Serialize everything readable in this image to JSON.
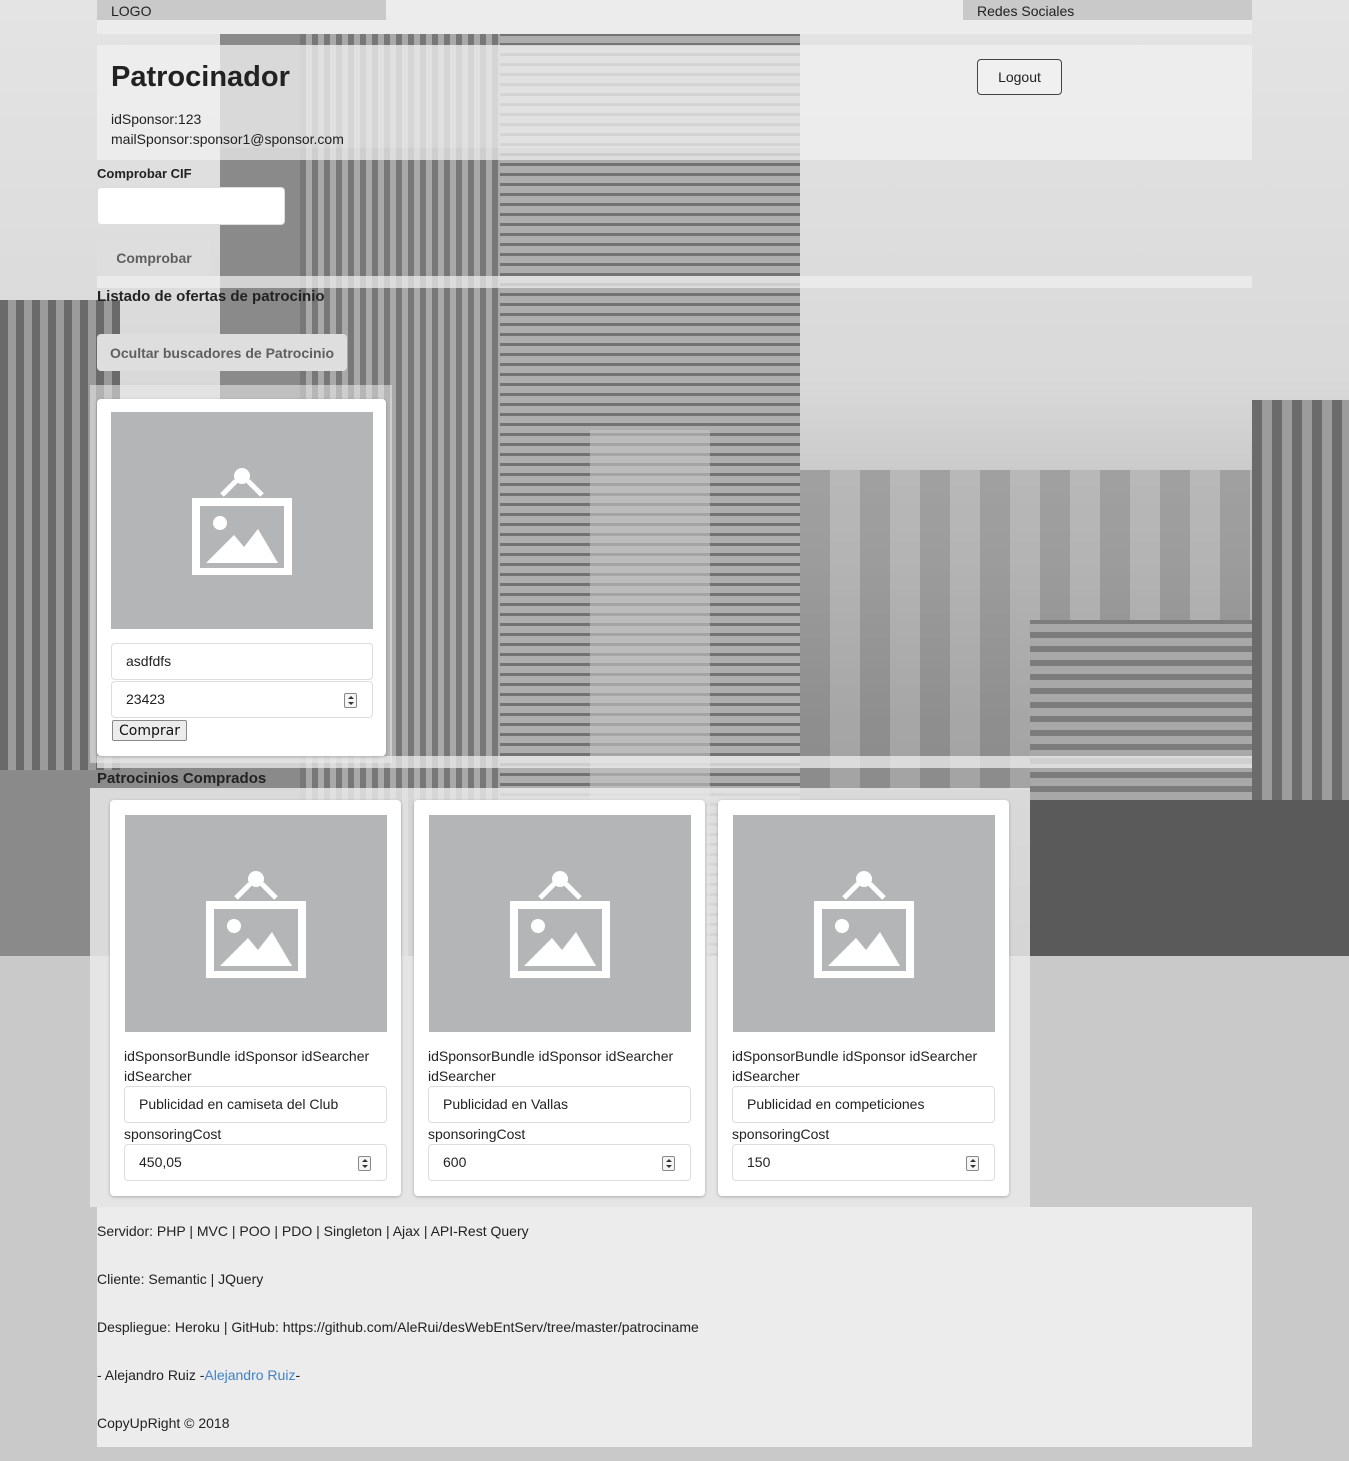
{
  "header": {
    "logo": "LOGO",
    "social": "Redes Sociales"
  },
  "profile": {
    "title": "Patrocinador",
    "id_line": "idSponsor:123",
    "mail_line": "mailSponsor:sponsor1@sponsor.com",
    "logout_label": "Logout"
  },
  "cif": {
    "label": "Comprobar CIF",
    "value": "",
    "button": "Comprobar"
  },
  "offers": {
    "title": "Listado de ofertas de patrocinio",
    "toggle_button": "Ocultar buscadores de Patrocinio",
    "items": [
      {
        "name": "asdfdfs",
        "cost": "23423",
        "buy_label": "Comprar"
      }
    ]
  },
  "purchased": {
    "title": "Patrocinios Comprados",
    "items": [
      {
        "ids_line": "idSponsorBundle idSponsor idSearcher",
        "searcher": "idSearcher",
        "name": "Publicidad en camiseta del Club",
        "cost_label": "sponsoringCost",
        "cost": "450,05"
      },
      {
        "ids_line": "idSponsorBundle idSponsor idSearcher",
        "searcher": "idSearcher",
        "name": "Publicidad en Vallas",
        "cost_label": "sponsoringCost",
        "cost": "600"
      },
      {
        "ids_line": "idSponsorBundle idSponsor idSearcher",
        "searcher": "idSearcher",
        "name": "Publicidad en competiciones",
        "cost_label": "sponsoringCost",
        "cost": "150"
      }
    ]
  },
  "footer": {
    "server": "Servidor: PHP | MVC | POO | PDO | Singleton | Ajax | API-Rest Query",
    "client": "Cliente: Semantic | JQuery",
    "deploy": "Despliegue: Heroku | GitHub: https://github.com/AleRui/desWebEntServ/tree/master/patrociname",
    "author_prefix": "- Alejandro Ruiz -",
    "author_link": "Alejandro Ruiz",
    "author_suffix": "-",
    "copyright": "CopyUpRight © 2018"
  },
  "icons": {
    "placeholder": "image-placeholder-icon",
    "spinner": "number-spinner-icon"
  }
}
